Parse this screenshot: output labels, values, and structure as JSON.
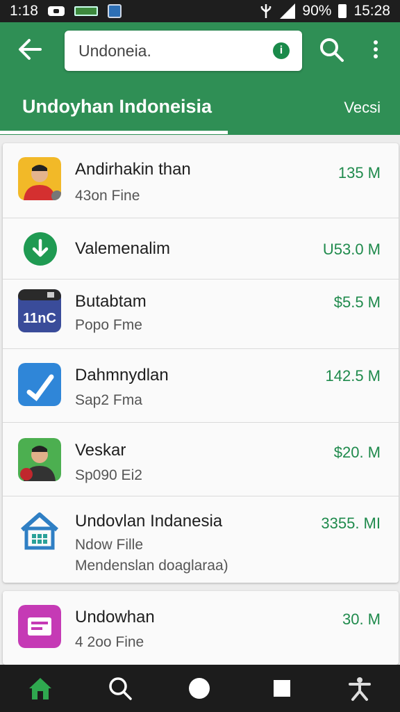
{
  "status_bar": {
    "time_left": "1:18",
    "battery_percent": "90%",
    "time_right": "15:28",
    "icons": [
      "game-controller-icon",
      "battery-pill-icon",
      "app-notification-icon",
      "usb-icon",
      "signal-icon",
      "battery-icon"
    ]
  },
  "app_bar": {
    "search_value": "Undoneia.",
    "tab_main": "Undoyhan Indoneisia",
    "tab_right": "Vecsi",
    "colors": {
      "primary": "#2f8f55",
      "accent": "#1f8a4c"
    }
  },
  "list": [
    {
      "name": "Andirhakin than",
      "sub": "43on Fine",
      "size": "135 M",
      "icon": "person-photo-icon"
    },
    {
      "name": "Valemenalim",
      "sub": "",
      "size": "U53.0 M",
      "icon": "download-check-icon"
    },
    {
      "name": "Butabtam",
      "sub": "Popo Fme",
      "size": "$5.5 M",
      "icon": "calendar-app-icon",
      "icon_text": "11nC"
    },
    {
      "name": "Dahmnydlan",
      "sub": "Sap2 Fma",
      "size": "142.5 M",
      "icon": "checkmark-app-icon"
    },
    {
      "name": "Veskar",
      "sub": "Sp090 Ei2",
      "size": "$20. M",
      "icon": "person-photo-icon"
    },
    {
      "name": "Undovlan Indanesia",
      "sub": "Ndow Fille",
      "sub2": "Mendenslan doaglaraa)",
      "size": "3355. MI",
      "icon": "house-app-icon"
    },
    {
      "name": "Undowhan",
      "sub": "4 2oo Fine",
      "size": "30. M",
      "icon": "document-app-icon"
    }
  ],
  "nav": [
    "home-icon",
    "search-icon",
    "circle-home-icon",
    "square-recents-icon",
    "accessibility-icon"
  ]
}
